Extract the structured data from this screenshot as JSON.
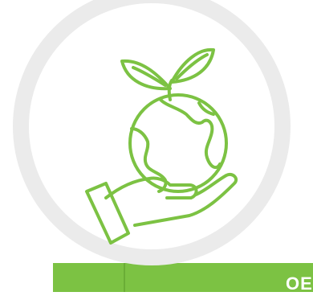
{
  "badge": {
    "icon": "hand-holding-globe-with-leaves-icon",
    "accent_color": "#7cc243",
    "ring_color": "#ebebeb"
  },
  "bottom_bar": {
    "text": "OE"
  }
}
